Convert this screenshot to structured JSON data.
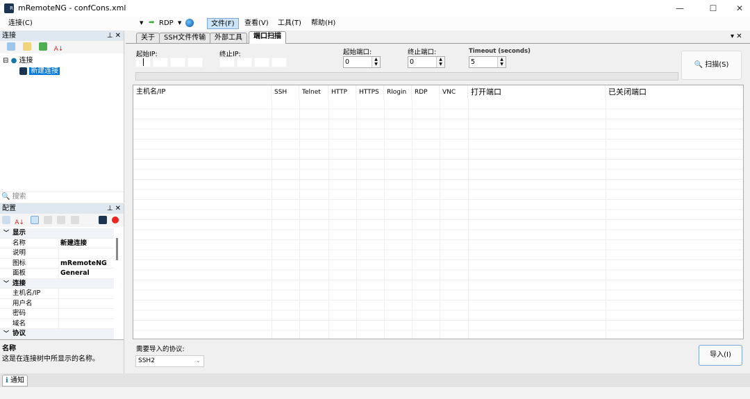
{
  "window": {
    "title": "mRemoteNG - confCons.xml",
    "controls": [
      "—",
      "☐",
      "✕"
    ]
  },
  "menubar": {
    "connect_menu": "连接(C)",
    "quick_protocol": "RDP",
    "menus": [
      "文件(F)",
      "查看(V)",
      "工具(T)",
      "帮助(H)"
    ]
  },
  "connections_panel": {
    "title": "连接",
    "root": "连接",
    "child": "新建连接",
    "search_placeholder": "搜索"
  },
  "config_panel": {
    "title": "配置",
    "rows": [
      {
        "cat": "显示"
      },
      {
        "k": "名称",
        "v": "新建连接"
      },
      {
        "k": "说明",
        "v": ""
      },
      {
        "k": "图标",
        "v": "mRemoteNG"
      },
      {
        "k": "面板",
        "v": "General"
      },
      {
        "cat": "连接"
      },
      {
        "k": "主机名/IP",
        "v": ""
      },
      {
        "k": "用户名",
        "v": ""
      },
      {
        "k": "密码",
        "v": ""
      },
      {
        "k": "域名",
        "v": ""
      },
      {
        "cat": "协议"
      }
    ],
    "desc_title": "名称",
    "desc_text": "这是在连接树中所显示的名称。"
  },
  "notification_tab": "通知",
  "tabs": [
    "关于",
    "SSH文件传输",
    "外部工具",
    "端口扫描"
  ],
  "port_scan": {
    "start_ip_label": "起始IP:",
    "end_ip_label": "终止IP:",
    "start_port_label": "起始端口:",
    "start_port": "0",
    "end_port_label": "终止端口:",
    "end_port": "0",
    "timeout_label": "Timeout (seconds)",
    "timeout": "5",
    "scan_button": "扫描(S)",
    "progress": 0,
    "columns": [
      "主机名/IP",
      "SSH",
      "Telnet",
      "HTTP",
      "HTTPS",
      "Rlogin",
      "RDP",
      "VNC",
      "打开端口",
      "已关闭端口"
    ],
    "import_protocol_label": "需要导入的协议:",
    "import_protocol": "SSH2",
    "import_button": "导入(I)"
  }
}
